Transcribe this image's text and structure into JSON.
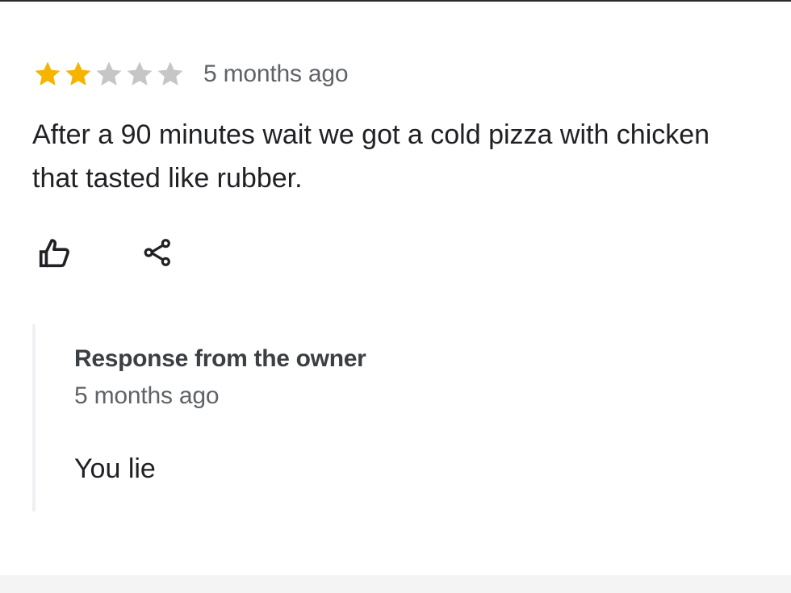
{
  "review": {
    "rating": 2,
    "max_rating": 5,
    "colors": {
      "star_filled": "#f4b400",
      "star_empty": "#c6c6c6"
    },
    "time": "5 months ago",
    "text": "After a 90 minutes wait we got a cold pizza with chicken that tasted like rubber.",
    "actions": {
      "like_icon": "thumbs-up-icon",
      "share_icon": "share-icon"
    }
  },
  "owner_response": {
    "title": "Response from the owner",
    "time": "5 months ago",
    "text": "You lie"
  }
}
